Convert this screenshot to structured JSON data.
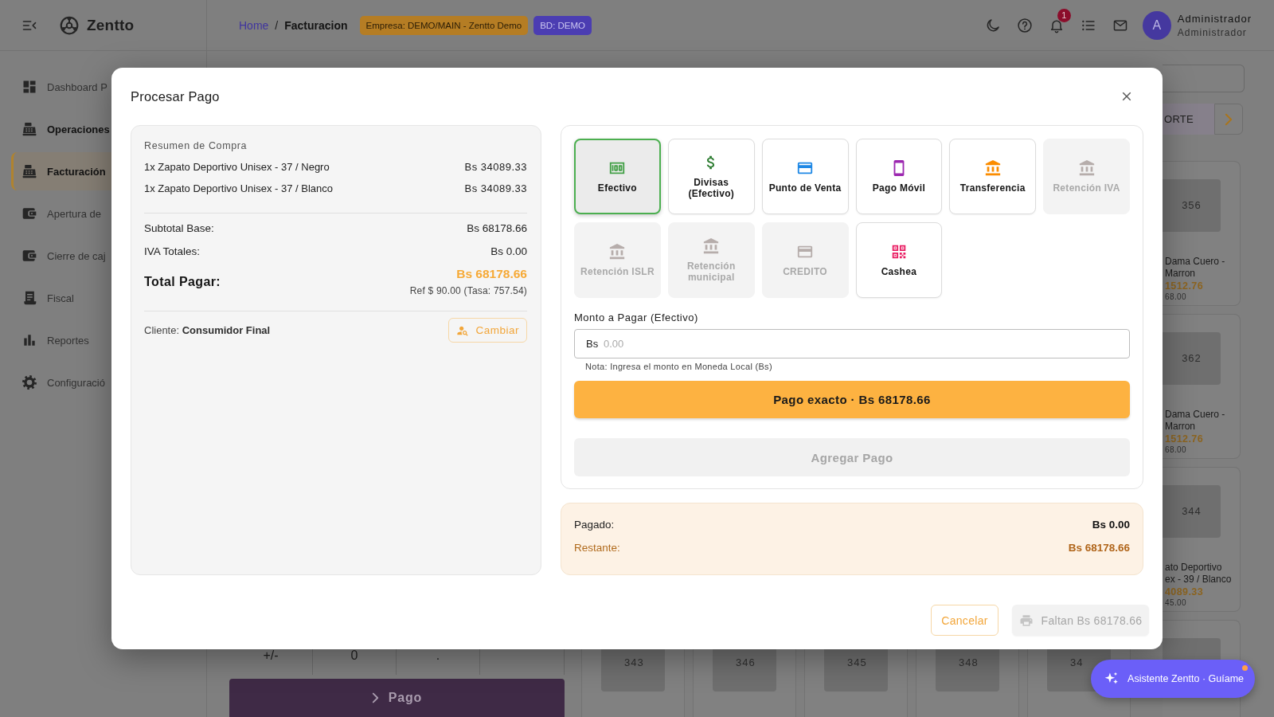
{
  "topbar": {
    "brand": "Zentto",
    "breadcrumb": [
      {
        "label": "Home",
        "kind": "link"
      },
      {
        "label": "Facturacion",
        "kind": "current"
      }
    ],
    "breadcrumb_separator": "/",
    "badges": [
      {
        "label": "Empresa: DEMO/MAIN - Zentto Demo",
        "kind": "company",
        "color": "#b57d24"
      },
      {
        "label": "BD: DEMO",
        "kind": "database",
        "color": "#4b3db2"
      }
    ],
    "notification_count": "1",
    "user": {
      "initial": "A",
      "name": "Administrador",
      "role": "Administrador"
    }
  },
  "sidebar": {
    "items": [
      {
        "label": "Dashboard P",
        "kind": "dashboard",
        "selected": false,
        "active": false
      },
      {
        "label": "Operaciones",
        "kind": "register",
        "selected": false,
        "active": true
      },
      {
        "label": "Facturación",
        "kind": "register",
        "selected": true,
        "active": false
      },
      {
        "label": "Apertura de",
        "kind": "wallet",
        "selected": false,
        "active": false
      },
      {
        "label": "Cierre de caj",
        "kind": "wallet",
        "selected": false,
        "active": false
      },
      {
        "label": "Fiscal",
        "kind": "receipt",
        "selected": false,
        "active": false
      },
      {
        "label": "Reportes",
        "kind": "chart",
        "selected": false,
        "active": false
      },
      {
        "label": "Configuració",
        "kind": "gear",
        "selected": false,
        "active": false
      }
    ]
  },
  "catalog": {
    "toolbar_button": "ORTE",
    "products": [
      {
        "code": "356",
        "name_lines": [
          "Dama Cuero -",
          "Marron"
        ],
        "price": "1512.76",
        "stock": "68.00"
      },
      {
        "code": "362",
        "name_lines": [
          "Dama Cuero -",
          "Marron"
        ],
        "price": "1512.76",
        "stock": "68.00"
      },
      {
        "code": "344",
        "name_lines": [
          "ato Deportivo",
          "ex - 39 / Blanco"
        ],
        "price": "4089.33",
        "stock": "45.00"
      }
    ],
    "bottom_row": [
      {
        "code": "343"
      },
      {
        "code": "346"
      },
      {
        "code": "345"
      },
      {
        "code": "348"
      },
      {
        "code": "34"
      }
    ]
  },
  "cart": {
    "keypad": [
      "+/-",
      "0",
      "."
    ],
    "pay_button": "Pago"
  },
  "modal": {
    "title": "Procesar Pago",
    "summary": {
      "heading": "Resumen de Compra",
      "items": [
        {
          "description": "1x Zapato Deportivo Unisex - 37 / Negro",
          "amount": "Bs 34089.33"
        },
        {
          "description": "1x Zapato Deportivo Unisex - 37 / Blanco",
          "amount": "Bs 34089.33"
        }
      ],
      "subtotal": {
        "label": "Subtotal Base:",
        "value": "Bs 68178.66"
      },
      "tax": {
        "label": "IVA Totales:",
        "value": "Bs 0.00"
      },
      "total": {
        "label": "Total Pagar:",
        "value": "Bs 68178.66",
        "reference": "Ref $ 90.00 (Tasa: 757.54)"
      },
      "customer": "Cliente: **Consumidor Final**",
      "change_button": "Cambiar"
    },
    "payment_methods": [
      {
        "label": "Efectivo",
        "kind": "cash",
        "selected": true,
        "disabled": false
      },
      {
        "label": "Divisas (Efectivo)",
        "kind": "dollar",
        "selected": false,
        "disabled": false
      },
      {
        "label": "Punto de Venta",
        "kind": "card",
        "selected": false,
        "disabled": false
      },
      {
        "label": "Pago Móvil",
        "kind": "phone",
        "selected": false,
        "disabled": false
      },
      {
        "label": "Transferencia",
        "kind": "bank",
        "selected": false,
        "disabled": false
      },
      {
        "label": "Retención IVA",
        "kind": "bank",
        "selected": false,
        "disabled": true
      },
      {
        "label": "Retención ISLR",
        "kind": "bank",
        "selected": false,
        "disabled": true
      },
      {
        "label": "Retención municipal",
        "kind": "bank",
        "selected": false,
        "disabled": true
      },
      {
        "label": "CREDITO",
        "kind": "card",
        "selected": false,
        "disabled": true
      },
      {
        "label": "Cashea",
        "kind": "qr",
        "selected": false,
        "disabled": false
      }
    ],
    "amount_field": {
      "label": "Monto a Pagar (Efectivo)",
      "prefix": "Bs",
      "placeholder": "0.00",
      "note": "Nota: Ingresa el monto en Moneda Local (Bs)"
    },
    "exact_button": "Pago exacto · Bs 68178.66",
    "add_button": {
      "label": "Agregar Pago",
      "disabled": true
    },
    "balance": [
      {
        "label": "Pagado:",
        "value": "Bs 0.00",
        "kind": "paid"
      },
      {
        "label": "Restante:",
        "value": "Bs 68178.66",
        "kind": "remaining"
      }
    ],
    "cancel_button": "Cancelar",
    "submit_button": {
      "label": "Faltan Bs 68178.66",
      "disabled": true
    }
  },
  "assistant": {
    "label": "Asistente Zentto · Guíame",
    "unread": true
  }
}
